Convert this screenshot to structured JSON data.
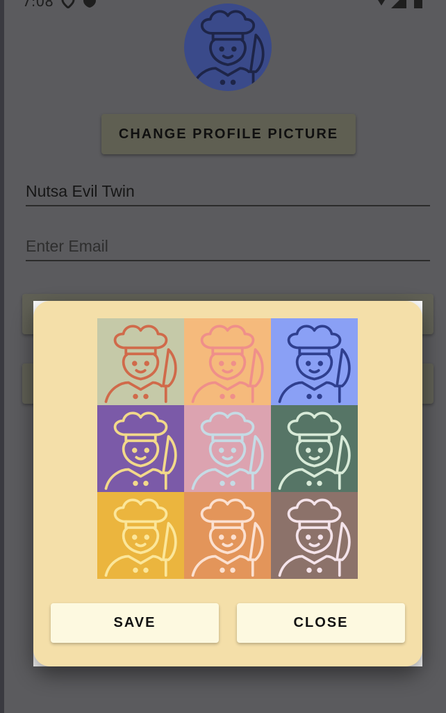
{
  "status_bar": {
    "time": "7:08"
  },
  "profile": {
    "avatar": {
      "icon": "chef-icon",
      "bg": "#3a4a8a",
      "stroke": "#1e2548"
    },
    "change_picture_label": "CHANGE PROFILE PICTURE",
    "name_value": "Nutsa Evil Twin",
    "email_placeholder": "Enter Email"
  },
  "dialog": {
    "avatars": [
      {
        "name": "avatar-option-1",
        "bg": "#c5c9a8",
        "stroke": "#d06a4a"
      },
      {
        "name": "avatar-option-2",
        "bg": "#f5ba7c",
        "stroke": "#ef8f8a"
      },
      {
        "name": "avatar-option-3",
        "bg": "#8aa0f5",
        "stroke": "#2f3f8f"
      },
      {
        "name": "avatar-option-4",
        "bg": "#7b5aa8",
        "stroke": "#f2d98a"
      },
      {
        "name": "avatar-option-5",
        "bg": "#dca3b0",
        "stroke": "#c5dbe5"
      },
      {
        "name": "avatar-option-6",
        "bg": "#567566",
        "stroke": "#d8ead8"
      },
      {
        "name": "avatar-option-7",
        "bg": "#ebb53e",
        "stroke": "#fbe69a"
      },
      {
        "name": "avatar-option-8",
        "bg": "#e3955a",
        "stroke": "#fbe0d0"
      },
      {
        "name": "avatar-option-9",
        "bg": "#8c726a",
        "stroke": "#f4e3ea"
      }
    ],
    "save_label": "SAVE",
    "close_label": "CLOSE"
  }
}
